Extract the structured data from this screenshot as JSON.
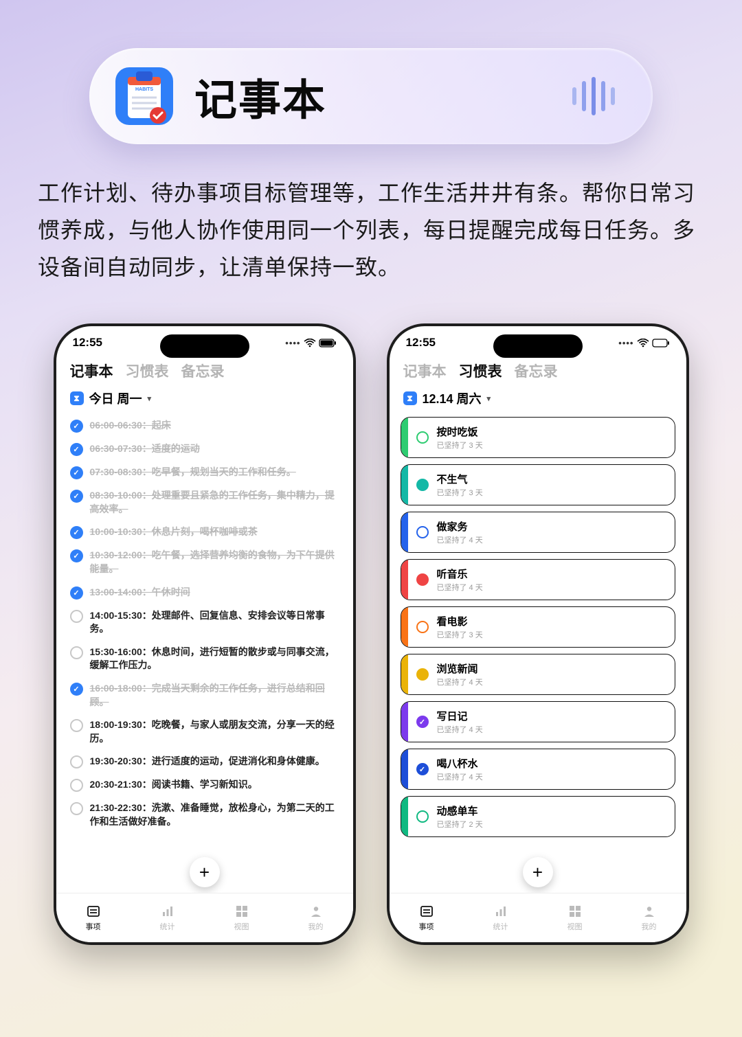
{
  "hero": {
    "title": "记事本"
  },
  "description": "工作计划、待办事项目标管理等，工作生活井井有条。帮你日常习惯养成，与他人协作使用同一个列表，每日提醒完成每日任务。多设备间自动同步，让清单保持一致。",
  "phone1": {
    "time": "12:55",
    "tabs": [
      "记事本",
      "习惯表",
      "备忘录"
    ],
    "active_tab": 0,
    "date_label": "今日 周一",
    "tasks": [
      {
        "done": true,
        "text": "06:00-06:30：起床"
      },
      {
        "done": true,
        "text": "06:30-07:30：适度的运动"
      },
      {
        "done": true,
        "text": "07:30-08:30：吃早餐，规划当天的工作和任务。"
      },
      {
        "done": true,
        "text": "08:30-10:00：处理重要且紧急的工作任务，集中精力，提高效率。"
      },
      {
        "done": true,
        "text": "10:00-10:30：休息片刻，喝杯咖啡或茶"
      },
      {
        "done": true,
        "text": "10:30-12:00：吃午餐，选择营养均衡的食物，为下午提供能量。"
      },
      {
        "done": true,
        "text": "13:00-14:00：午休时间"
      },
      {
        "done": false,
        "text": "14:00-15:30：处理邮件、回复信息、安排会议等日常事务。"
      },
      {
        "done": false,
        "text": "15:30-16:00：休息时间，进行短暂的散步或与同事交流，缓解工作压力。"
      },
      {
        "done": true,
        "text": "16:00-18:00：完成当天剩余的工作任务，进行总结和回顾。"
      },
      {
        "done": false,
        "text": "18:00-19:30：吃晚餐，与家人或朋友交流，分享一天的经历。"
      },
      {
        "done": false,
        "text": "19:30-20:30：进行适度的运动，促进消化和身体健康。"
      },
      {
        "done": false,
        "text": "20:30-21:30：阅读书籍、学习新知识。"
      },
      {
        "done": false,
        "text": "21:30-22:30：洗漱、准备睡觉，放松身心，为第二天的工作和生活做好准备。"
      }
    ],
    "nav": [
      "事项",
      "统计",
      "视图",
      "我的"
    ],
    "nav_active": 0
  },
  "phone2": {
    "time": "12:55",
    "tabs": [
      "记事本",
      "习惯表",
      "备忘录"
    ],
    "active_tab": 1,
    "date_label": "12.14 周六",
    "habits": [
      {
        "color": "#2ecc71",
        "dot": "ring",
        "name": "按时吃饭",
        "sub": "已坚持了 3 天"
      },
      {
        "color": "#14b8a6",
        "dot": "full",
        "name": "不生气",
        "sub": "已坚持了 3 天"
      },
      {
        "color": "#2563eb",
        "dot": "ring",
        "name": "做家务",
        "sub": "已坚持了 4 天"
      },
      {
        "color": "#ef4444",
        "dot": "full",
        "name": "听音乐",
        "sub": "已坚持了 4 天"
      },
      {
        "color": "#f97316",
        "dot": "ring",
        "name": "看电影",
        "sub": "已坚持了 3 天"
      },
      {
        "color": "#eab308",
        "dot": "full",
        "name": "浏览新闻",
        "sub": "已坚持了 4 天"
      },
      {
        "color": "#7c3aed",
        "dot": "check",
        "name": "写日记",
        "sub": "已坚持了 4 天"
      },
      {
        "color": "#1d4ed8",
        "dot": "check",
        "name": "喝八杯水",
        "sub": "已坚持了 4 天"
      },
      {
        "color": "#10b981",
        "dot": "ring",
        "name": "动感单车",
        "sub": "已坚持了 2 天"
      }
    ],
    "nav": [
      "事项",
      "统计",
      "视图",
      "我的"
    ],
    "nav_active": 0
  }
}
